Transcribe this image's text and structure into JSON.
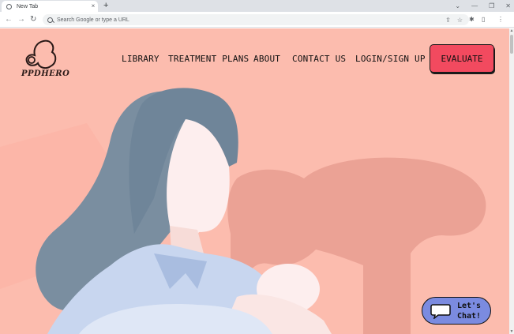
{
  "browser": {
    "tab_title": "New Tab",
    "tab_close": "×",
    "new_tab": "+",
    "window_controls": [
      "⌄",
      "—",
      "❐",
      "✕"
    ],
    "back": "←",
    "forward": "→",
    "reload": "↻",
    "omnibox_placeholder": "Search Google or type a URL",
    "share_icon": "⇪",
    "bookmark_icon": "☆",
    "extensions_icon": "✱",
    "sidepanel_icon": "▯",
    "menu_icon": "⋮"
  },
  "site": {
    "logo_text": "PPDHERO",
    "nav": {
      "library": "LIBRARY",
      "treatment_plans": "TREATMENT PLANS",
      "about": "ABOUT",
      "contact_us": "CONTACT US",
      "login_signup": "LOGIN/SIGN UP"
    },
    "evaluate_button": "EVALUATE",
    "chat_button": {
      "line1": "Let's",
      "line2": "Chat!"
    }
  },
  "colors": {
    "background": "#fcbcae",
    "accent": "#f24a5f",
    "chat": "#7b8be0",
    "hair": "#7a8ea0",
    "shirt": "#c8d6ef"
  }
}
